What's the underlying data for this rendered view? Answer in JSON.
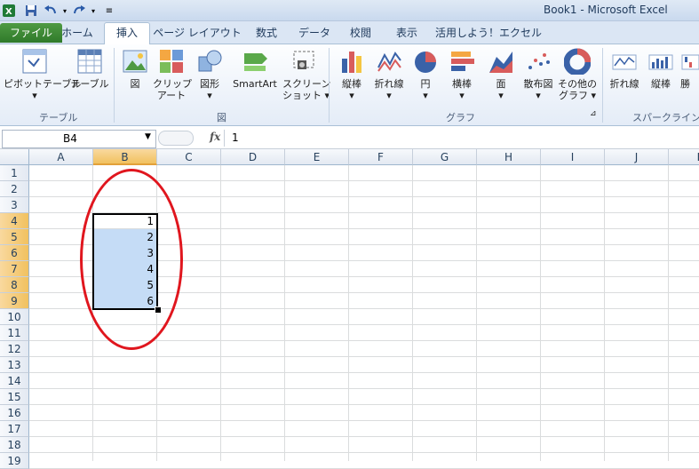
{
  "titlebar": {
    "title": "Book1 - Microsoft Excel",
    "icons": [
      "excel-icon",
      "save-icon",
      "undo-icon",
      "redo-icon",
      "customize-icon"
    ]
  },
  "tabs": [
    {
      "label": "ファイル",
      "id": "file"
    },
    {
      "label": "ホーム",
      "id": "home"
    },
    {
      "label": "挿入",
      "id": "insert"
    },
    {
      "label": "ページ レイアウト",
      "id": "page-layout"
    },
    {
      "label": "数式",
      "id": "formulas"
    },
    {
      "label": "データ",
      "id": "data"
    },
    {
      "label": "校閲",
      "id": "review"
    },
    {
      "label": "表示",
      "id": "view"
    },
    {
      "label": "活用しよう！エクセル",
      "id": "addin"
    }
  ],
  "ribbon": {
    "pivot": {
      "line1": "ピボットテーブル",
      "line2": "▾"
    },
    "table": {
      "line1": "テーブル"
    },
    "picture": {
      "line1": "図"
    },
    "clipart": {
      "line1": "クリップ",
      "line2": "アート"
    },
    "shapes": {
      "line1": "図形",
      "line2": "▾"
    },
    "smartart": {
      "line1": "SmartArt"
    },
    "screenshot": {
      "line1": "スクリーン",
      "line2": "ショット ▾"
    },
    "column": {
      "line1": "縦棒",
      "line2": "▾"
    },
    "line": {
      "line1": "折れ線",
      "line2": "▾"
    },
    "pie": {
      "line1": "円",
      "line2": "▾"
    },
    "bar": {
      "line1": "横棒",
      "line2": "▾"
    },
    "area": {
      "line1": "面",
      "line2": "▾"
    },
    "scatter": {
      "line1": "散布図",
      "line2": "▾"
    },
    "other": {
      "line1": "その他の",
      "line2": "グラフ ▾"
    },
    "spark_line": {
      "line1": "折れ線"
    },
    "spark_column": {
      "line1": "縦棒"
    },
    "spark_winloss": {
      "line1": "勝"
    },
    "groups": {
      "table": "テーブル",
      "illust": "図",
      "chart": "グラフ",
      "sparkline": "スパークライン"
    }
  },
  "formula": {
    "namebox": "B4",
    "fx": "fx",
    "value": "1"
  },
  "sheet": {
    "columns": [
      "A",
      "B",
      "C",
      "D",
      "E",
      "F",
      "G",
      "H",
      "I",
      "J",
      "K"
    ],
    "rows": [
      "1",
      "2",
      "3",
      "4",
      "5",
      "6",
      "7",
      "8",
      "9",
      "10",
      "11",
      "12",
      "13",
      "14",
      "15",
      "16",
      "17",
      "18",
      "19"
    ],
    "b_cells": [
      "1",
      "2",
      "3",
      "4",
      "5",
      "6"
    ],
    "selected_column": "B",
    "selection_color": "#c5dcf6",
    "annotation_color": "#e0161e"
  }
}
